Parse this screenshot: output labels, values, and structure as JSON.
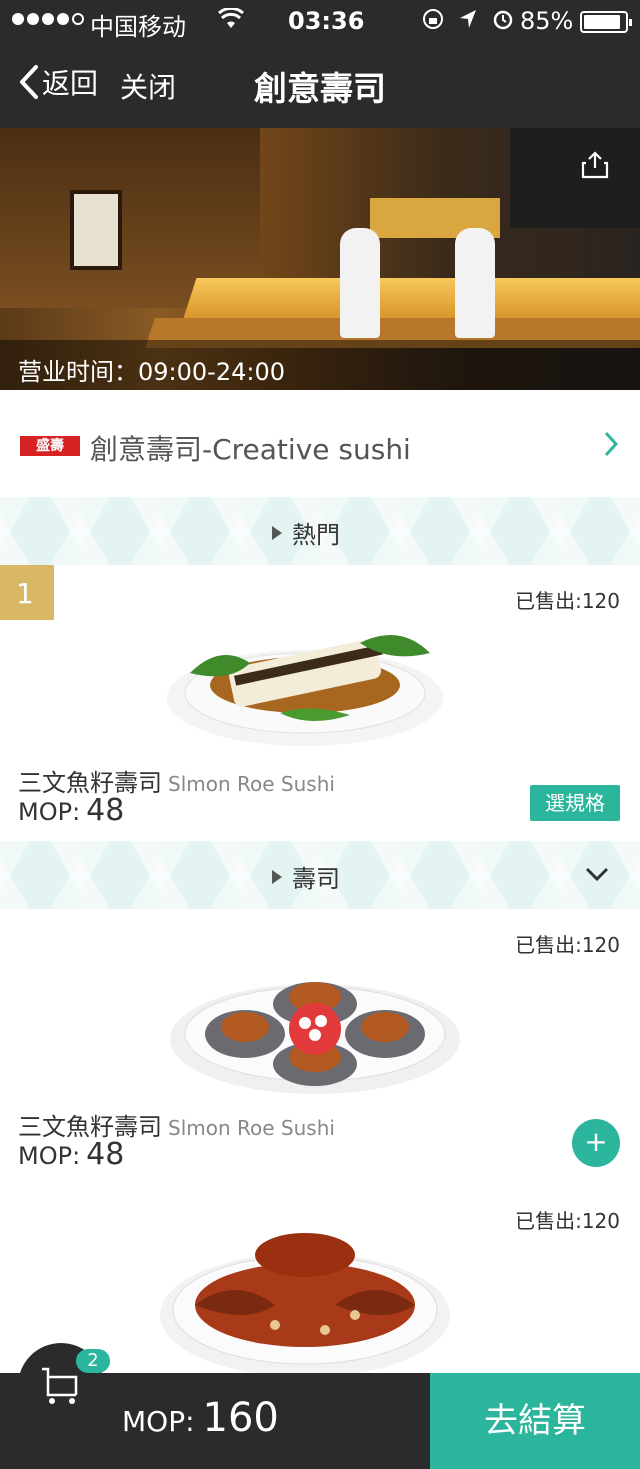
{
  "status_bar": {
    "carrier": "中国移动",
    "time": "03:36",
    "battery": "85%",
    "battery_level": 0.85
  },
  "nav": {
    "back_label": "返回",
    "close_label": "关闭",
    "title": "創意壽司"
  },
  "hero": {
    "hours": "营业时间：09:00-24:00"
  },
  "shop": {
    "logo_text": "盛壽",
    "name": "創意壽司-Creative sushi"
  },
  "categories": [
    {
      "label": "熱門"
    },
    {
      "label": "壽司"
    }
  ],
  "items": [
    {
      "rank": "1",
      "sold": "已售出:120",
      "name": "三文魚籽壽司",
      "name_en": "Slmon Roe Sushi",
      "currency": "MOP:",
      "price": "48",
      "action": "選規格"
    },
    {
      "sold": "已售出:120",
      "name": "三文魚籽壽司",
      "name_en": "Slmon Roe Sushi",
      "currency": "MOP:",
      "price": "48",
      "action": "+"
    },
    {
      "sold": "已售出:120"
    }
  ],
  "cart": {
    "count": "2",
    "currency": "MOP:",
    "total": "160",
    "checkout_label": "去結算"
  },
  "colors": {
    "accent": "#2bb59c",
    "dark": "#2b2b2b",
    "rank_gold": "#d8b864"
  }
}
